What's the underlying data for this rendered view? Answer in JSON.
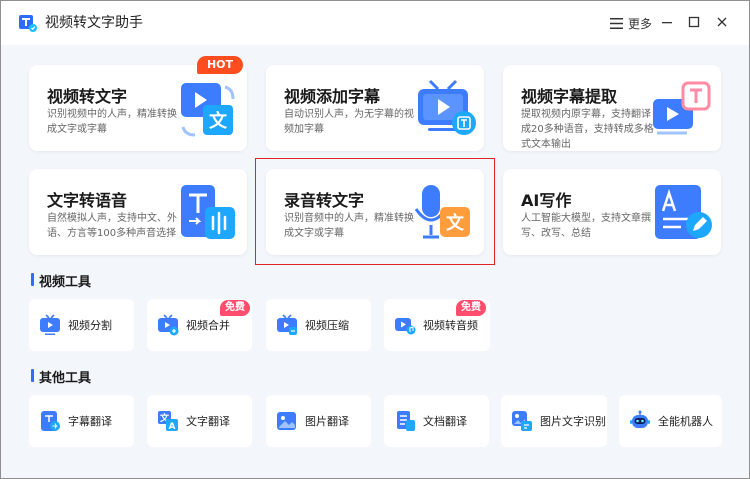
{
  "app": {
    "title": "视频转文字助手",
    "menu_label": "更多"
  },
  "cards": [
    {
      "title": "视频转文字",
      "desc": "识别视频中的人声，精准转换成文字或字幕",
      "badge": "HOT"
    },
    {
      "title": "视频添加字幕",
      "desc": "自动识别人声，为无字幕的视频加字幕"
    },
    {
      "title": "视频字幕提取",
      "desc": "提取视频内原字幕，支持翻译成20多种语音，支持转成多格式文本输出"
    },
    {
      "title": "文字转语音",
      "desc": "自然模拟人声，支持中文、外语、方言等100多种声音选择"
    },
    {
      "title": "录音转文字",
      "desc": "识别音频中的人声，精准转换成文字或字幕",
      "selected": true
    },
    {
      "title": "AI写作",
      "desc": "人工智能大模型，支持文章撰写、改写、总结"
    }
  ],
  "sections": {
    "video_tools": "视频工具",
    "other_tools": "其他工具"
  },
  "video_tools": [
    {
      "label": "视频分割"
    },
    {
      "label": "视频合并",
      "badge": "免费"
    },
    {
      "label": "视频压缩"
    },
    {
      "label": "视频转音频",
      "badge": "免费"
    }
  ],
  "other_tools": [
    {
      "label": "字幕翻译"
    },
    {
      "label": "文字翻译"
    },
    {
      "label": "图片翻译"
    },
    {
      "label": "文档翻译"
    },
    {
      "label": "图片文字识别"
    },
    {
      "label": "全能机器人"
    }
  ],
  "colors": {
    "accent": "#2e6bff",
    "hot": "#ff4d1f",
    "free": "#ff4d6d",
    "selection": "#e02424"
  }
}
